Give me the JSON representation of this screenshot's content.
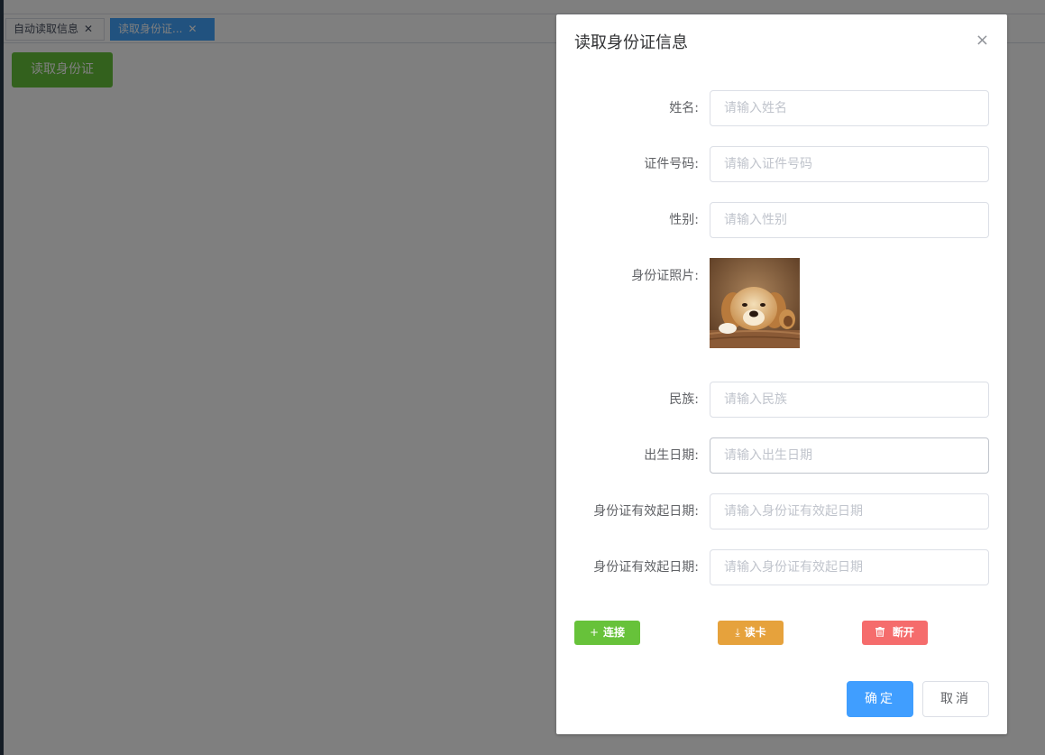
{
  "tabs": [
    {
      "label": "自动读取信息",
      "close": "✕"
    },
    {
      "label": "读取身份证...",
      "close": "✕"
    }
  ],
  "page": {
    "read_button": "读取身份证"
  },
  "dialog": {
    "title": "读取身份证信息",
    "close": "×",
    "fields": [
      {
        "label": "姓名:",
        "placeholder": "请输入姓名"
      },
      {
        "label": "证件号码:",
        "placeholder": "请输入证件号码"
      },
      {
        "label": "性别:",
        "placeholder": "请输入性别"
      },
      {
        "label": "民族:",
        "placeholder": "请输入民族"
      },
      {
        "label": "出生日期:",
        "placeholder": "请输入出生日期"
      },
      {
        "label": "身份证有效起日期:",
        "placeholder": "请输入身份证有效起日期"
      },
      {
        "label": "身份证有效起日期:",
        "placeholder": "请输入身份证有效起日期"
      }
    ],
    "photo_label": "身份证照片:",
    "actions": {
      "connect": "连接",
      "read": "读卡",
      "disconnect": "断开"
    },
    "footer": {
      "ok": "确定",
      "cancel": "取消"
    }
  },
  "colors": {
    "success": "#67c23a",
    "warning": "#e6a23c",
    "danger": "#f56c6c",
    "primary": "#409eff",
    "active_tab": "#42a5ff"
  },
  "icons": {
    "connect": "plus-icon",
    "read": "download-icon",
    "disconnect": "trash-icon",
    "photo": "puppy-photo"
  }
}
